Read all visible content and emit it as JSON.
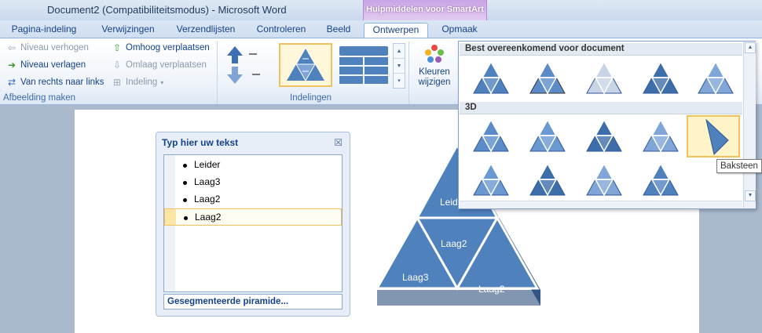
{
  "window": {
    "title": "Document2 (Compatibiliteitsmodus)  -  Microsoft Word",
    "contextual_group": "Hulpmiddelen voor SmartArt"
  },
  "tabs": [
    "Pagina-indeling",
    "Verwijzingen",
    "Verzendlijsten",
    "Controleren",
    "Beeld",
    "Ontwerpen",
    "Opmaak"
  ],
  "active_tab": "Ontwerpen",
  "ribbon": {
    "afbeelding_maken": {
      "label": "Afbeelding maken",
      "niveau_verhogen": "Niveau verhogen",
      "niveau_verlagen": "Niveau verlagen",
      "van_rechts_naar_links": "Van rechts naar links",
      "omhoog_verplaatsen": "Omhoog verplaatsen",
      "omlaag_verplaatsen": "Omlaag verplaatsen",
      "indeling": "Indeling"
    },
    "indelingen": {
      "label": "Indelingen"
    },
    "kleuren_wijzigen": {
      "line1": "Kleuren",
      "line2": "wijzigen"
    }
  },
  "text_pane": {
    "title": "Typ hier uw tekst",
    "items": [
      "Leider",
      "Laag3",
      "Laag2",
      "Laag2"
    ],
    "selected_index": 3,
    "footer": "Gesegmenteerde piramide..."
  },
  "pyramid": {
    "segments": [
      "Leid",
      "Laag2",
      "Laag3",
      "Laag2"
    ]
  },
  "gallery": {
    "section1": "Best overeenkomend voor document",
    "section2": "3D",
    "selected": "Baksteen"
  },
  "tooltip": "Baksteen",
  "colors": {
    "accent": "#4f81bd",
    "selection": "#f1c15f",
    "ribbon_text": "#15428b"
  }
}
